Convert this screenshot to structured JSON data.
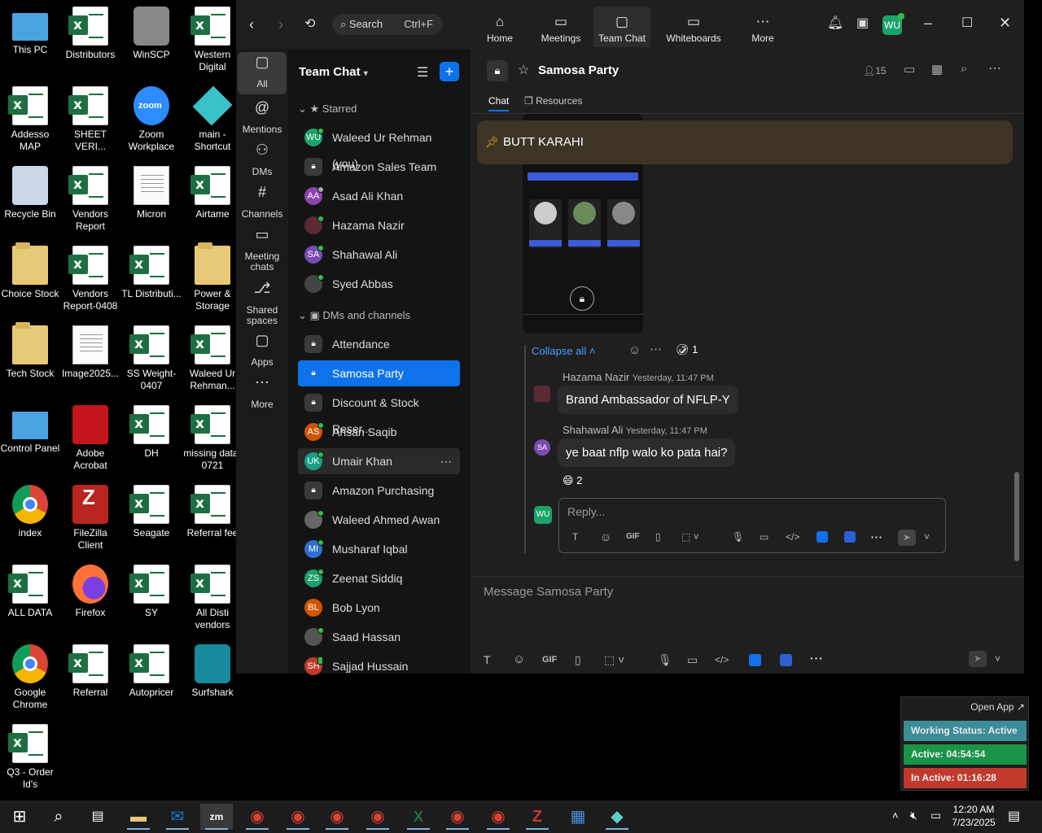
{
  "desktop_icons": [
    {
      "label": "This PC",
      "type": "pc"
    },
    {
      "label": "Distributors",
      "type": "excel"
    },
    {
      "label": "WinSCP",
      "type": "winscp"
    },
    {
      "label": "Western Digital",
      "type": "excel"
    },
    {
      "label": "Addesso MAP",
      "type": "excel"
    },
    {
      "label": "SHEET VERI...",
      "type": "excel"
    },
    {
      "label": "Zoom Workplace",
      "type": "zoom"
    },
    {
      "label": "main - Shortcut",
      "type": "cube"
    },
    {
      "label": "Recycle Bin",
      "type": "bin"
    },
    {
      "label": "Vendors Report",
      "type": "excel"
    },
    {
      "label": "Micron",
      "type": "doc"
    },
    {
      "label": "Airtame",
      "type": "excel"
    },
    {
      "label": "Choice Stock",
      "type": "folder"
    },
    {
      "label": "Vendors Report-0408",
      "type": "excel"
    },
    {
      "label": "TL Distributi...",
      "type": "excel"
    },
    {
      "label": "Power & Storage",
      "type": "folder"
    },
    {
      "label": "Tech Stock",
      "type": "folder"
    },
    {
      "label": "Image2025...",
      "type": "doc"
    },
    {
      "label": "SS Weight-0407",
      "type": "excel"
    },
    {
      "label": "Waleed Ur Rehman...",
      "type": "excel"
    },
    {
      "label": "Control Panel",
      "type": "control"
    },
    {
      "label": "Adobe Acrobat",
      "type": "acrobat"
    },
    {
      "label": "DH",
      "type": "excel"
    },
    {
      "label": "missing data-0721",
      "type": "excel"
    },
    {
      "label": "index",
      "type": "chrome"
    },
    {
      "label": "FileZilla Client",
      "type": "filezilla"
    },
    {
      "label": "Seagate",
      "type": "excel"
    },
    {
      "label": "Referral fee",
      "type": "excel"
    },
    {
      "label": "ALL DATA",
      "type": "excel"
    },
    {
      "label": "Firefox",
      "type": "firefox"
    },
    {
      "label": "SY",
      "type": "excel"
    },
    {
      "label": "All Disti vendors",
      "type": "excel"
    },
    {
      "label": "Google Chrome",
      "type": "chrome"
    },
    {
      "label": "Referral",
      "type": "excel"
    },
    {
      "label": "Autopricer",
      "type": "excel"
    },
    {
      "label": "Surfshark",
      "type": "surfshark"
    },
    {
      "label": "Q3 - Order Id's",
      "type": "excel"
    }
  ],
  "topbar": {
    "search_label": "Search",
    "search_shortcut": "Ctrl+F",
    "nav": [
      {
        "label": "Home",
        "icon": "home-icon"
      },
      {
        "label": "Meetings",
        "icon": "video-icon"
      },
      {
        "label": "Team Chat",
        "icon": "chat-icon"
      },
      {
        "label": "Whiteboards",
        "icon": "whiteboard-icon"
      },
      {
        "label": "More",
        "icon": "more-icon"
      }
    ],
    "avatar": "WU"
  },
  "rail": [
    {
      "label": "All"
    },
    {
      "label": "Mentions"
    },
    {
      "label": "DMs"
    },
    {
      "label": "Channels"
    },
    {
      "label": "Meeting chats"
    },
    {
      "label": "Shared spaces"
    },
    {
      "label": "Apps"
    },
    {
      "label": "More"
    }
  ],
  "sidebar": {
    "title": "Team Chat",
    "starred_label": "Starred",
    "starred": [
      {
        "name": "Waleed Ur Rehman (you)",
        "initials": "WU",
        "color": "#1aa36b",
        "status": "online"
      },
      {
        "name": "Amazon Sales Team",
        "initials": "",
        "color": "#3a3a3a",
        "status": "lock"
      },
      {
        "name": "Asad Ali Khan",
        "initials": "AA",
        "color": "#8e44ad",
        "status": "away"
      },
      {
        "name": "Hazama Nazir",
        "initials": "",
        "color": "#5a2a35",
        "status": "online"
      },
      {
        "name": "Shahawal Ali",
        "initials": "SA",
        "color": "#7b4bb5",
        "status": "online"
      },
      {
        "name": "Syed Abbas",
        "initials": "",
        "color": "#444",
        "status": "online"
      }
    ],
    "dm_label": "DMs and channels",
    "dms": [
      {
        "name": "Attendance",
        "initials": "",
        "color": "#3a3a3a",
        "status": "lock"
      },
      {
        "name": "Samosa Party",
        "initials": "",
        "color": "#0e72ed",
        "status": "lock"
      },
      {
        "name": "Discount & Stock Reser...",
        "initials": "",
        "color": "#3a3a3a",
        "status": "lock"
      },
      {
        "name": "Ahsan Saqib",
        "initials": "AS",
        "color": "#d35400",
        "status": "online"
      },
      {
        "name": "Umair Khan",
        "initials": "UK",
        "color": "#16a085",
        "status": "online"
      },
      {
        "name": "Amazon Purchasing",
        "initials": "",
        "color": "#3a3a3a",
        "status": "lock"
      },
      {
        "name": "Waleed Ahmed Awan",
        "initials": "",
        "color": "#666",
        "status": "online"
      },
      {
        "name": "Musharaf Iqbal",
        "initials": "MI",
        "color": "#2e6fd1",
        "status": "online"
      },
      {
        "name": "Zeenat Siddiq",
        "initials": "ZS",
        "color": "#1e9e6e",
        "status": "online"
      },
      {
        "name": "Bob Lyon",
        "initials": "BL",
        "color": "#d35400",
        "status": "none"
      },
      {
        "name": "Saad Hassan",
        "initials": "",
        "color": "#555",
        "status": "online"
      },
      {
        "name": "Sajjad Hussain",
        "initials": "SH",
        "color": "#c0392b",
        "status": "mobile"
      }
    ]
  },
  "channel": {
    "name": "Samosa Party",
    "members": "15",
    "tabs": [
      "Chat",
      "Resources"
    ],
    "pinned": "BUTT KARAHI",
    "collapse_label": "Collapse all",
    "reaction_top": "1",
    "messages": [
      {
        "author": "Hazama Nazir",
        "time": "Yesterday, 11:47 PM",
        "text": "Brand Ambassador of NFLP-Y",
        "initials": ""
      },
      {
        "author": "Shahawal Ali",
        "time": "Yesterday, 11:47 PM",
        "text": "ye baat nflp walo ko pata hai?",
        "initials": "SA"
      }
    ],
    "reaction_bottom": "2",
    "reply_placeholder": "Reply...",
    "reply_avatar": "WU",
    "composer_placeholder": "Message Samosa Party",
    "gif": "GIF"
  },
  "widget": {
    "open_app": "Open App ↗",
    "working": "Working Status: Active",
    "active": "Active: 04:54:54",
    "inactive": "In Active: 01:16:28",
    "colors": {
      "working": "#3d8c99",
      "active": "#1a9448",
      "inactive": "#c0392b"
    }
  },
  "taskbar": {
    "time": "12:20 AM",
    "date": "7/23/2025"
  }
}
